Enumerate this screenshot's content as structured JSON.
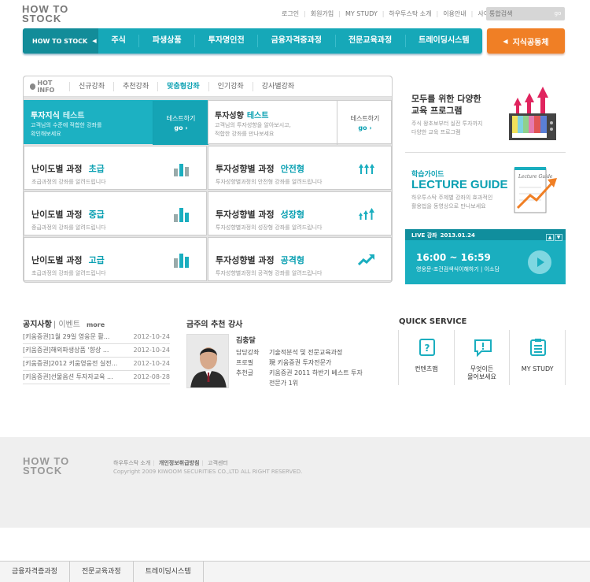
{
  "logo": {
    "line1": "HOW TO",
    "line2": "STOCK"
  },
  "topnav": [
    "로그인",
    "회원가입",
    "MY STUDY",
    "하우투스탁 소개",
    "이용안내",
    "사이트맵"
  ],
  "search": {
    "placeholder": "통합검색",
    "go": "go"
  },
  "mainnav": {
    "brand": "HOW TO STOCK",
    "items": [
      "주식",
      "파생상품",
      "투자명인전",
      "금융자격증과정",
      "전문교육과정",
      "트레이딩시스템"
    ],
    "special": "지식공동체"
  },
  "hotinfo": {
    "label": "HOT INFO",
    "tabs": [
      "신규강좌",
      "추천강좌",
      "맞춤형강좌",
      "인기강좌",
      "강사별강좌"
    ],
    "active_tab": 2,
    "tests": [
      {
        "title": "투자지식",
        "accent": "테스트",
        "desc1": "고객님의 수준에 적합한 강좌를",
        "desc2": "확인해보세요",
        "button": "테스트하기",
        "go": "go ›"
      },
      {
        "title": "투자성향",
        "accent": "테스트",
        "desc1": "고객님의 투자성향을 알아보시고,",
        "desc2": "적합한 강좌를 만나보세요",
        "button": "테스트하기",
        "go": "go ›"
      }
    ],
    "cards": [
      {
        "title": "난이도별 과정",
        "accent": "초급",
        "sub": "초급과정의 강좌를 알려드립니다",
        "icon": "bar-chart-icon"
      },
      {
        "title": "투자성향별 과정",
        "accent": "안전형",
        "sub": "투자성향별과정의 안전형 강좌를 알려드립니다",
        "icon": "triple-up-arrow-icon"
      },
      {
        "title": "난이도별 과정",
        "accent": "중급",
        "sub": "중급과정의 강좌를 알려드립니다",
        "icon": "bar-chart-icon"
      },
      {
        "title": "투자성향별 과정",
        "accent": "성장형",
        "sub": "투자성향별과정의 성장형 강좌를 알려드립니다",
        "icon": "growth-arrow-icon"
      },
      {
        "title": "난이도별 과정",
        "accent": "고급",
        "sub": "초급과정의 강좌를 알려드립니다",
        "icon": "bar-chart-icon"
      },
      {
        "title": "투자성향별 과정",
        "accent": "공격형",
        "sub": "투자성향별과정의 공격형 강좌를 알려드립니다",
        "icon": "trend-up-icon"
      }
    ]
  },
  "promo1": {
    "title1": "모두를 위한 다양한",
    "title2": "교육 프로그램",
    "desc1": "주식 왕초보부터 실전 투자까지",
    "desc2": "다양한 교육 프로그램"
  },
  "promo2": {
    "label": "학습가이드",
    "big": "LECTURE GUIDE",
    "desc1": "하우투스탁 주제별 강좌의 효과적인",
    "desc2": "활용법을 동영상으로 만나보세요",
    "book_label": "Lecture Guide"
  },
  "live": {
    "label": "LIVE 강좌",
    "date": "2013.01.24",
    "time": "16:00 ~ 16:59",
    "info": "영웅문-조건검색식이해하기 | 이소담"
  },
  "notice": {
    "title": "공지사항",
    "tab2": "| 이벤트",
    "more": "more",
    "rows": [
      {
        "text": "[키움증권]1월 29일 영웅문 활...",
        "date": "2012-10-24"
      },
      {
        "text": "[키움증권]해외파생상품 '향상 ...",
        "date": "2012-10-24"
      },
      {
        "text": "[키움증권]2012 키움영웅전 실전...",
        "date": "2012-10-24"
      },
      {
        "text": "[키움증권]선물옵션 투자자교육 ...",
        "date": "2012-08-28"
      }
    ]
  },
  "recommend": {
    "title": "금주의 추천 강사",
    "name": "김충달",
    "rows": [
      {
        "k": "담당강좌",
        "v": "기술적분석 및 전문교육과정"
      },
      {
        "k": "프로필",
        "v": "現 키움증권 투자전문가"
      },
      {
        "k": "추천글",
        "v": "키움증권 2011 하반기 베스트 투자"
      },
      {
        "k": "",
        "v": "전문가 1위"
      }
    ]
  },
  "quick": {
    "title": "QUICK SERVICE",
    "items": [
      {
        "l1": "컨텐츠맵",
        "l2": ""
      },
      {
        "l1": "무엇이든",
        "l2": "물어보세요"
      },
      {
        "l1": "MY STUDY",
        "l2": ""
      }
    ]
  },
  "footer": {
    "links": [
      "하우투스탁 소개",
      "개인정보취급방침",
      "고객센터"
    ],
    "copyright": "Copyright 2009 KIWOOM SECURITIES CO.,LTD ALL RIGHT RESERVED."
  },
  "bottombar": [
    "금융자격증과정",
    "전문교육과정",
    "트레이딩시스템"
  ],
  "colors": {
    "accent": "#1aaebf",
    "orange": "#f07f25"
  }
}
